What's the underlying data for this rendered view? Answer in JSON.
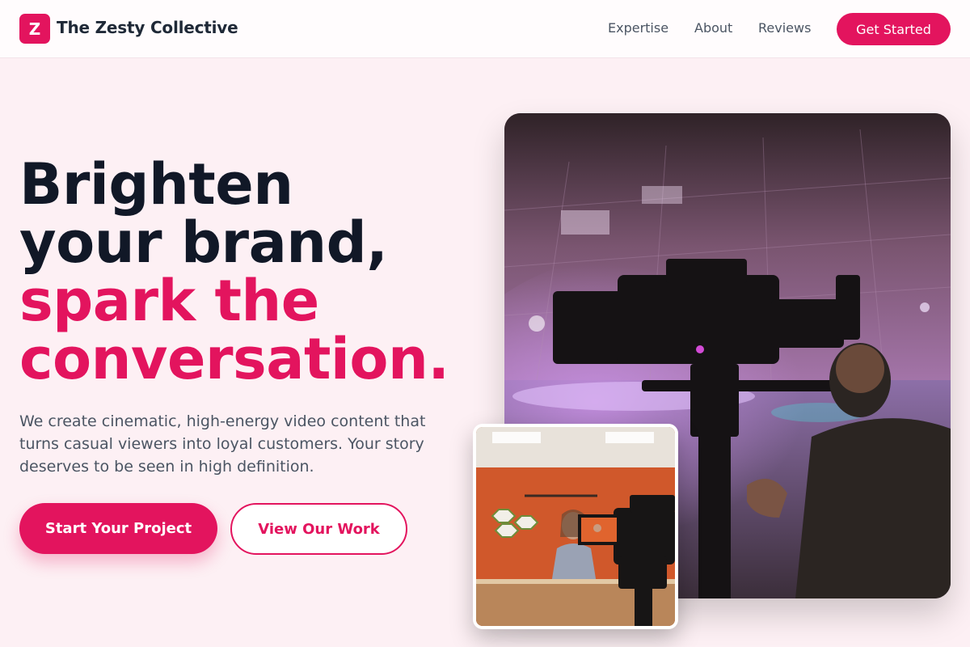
{
  "header": {
    "logo_letter": "Z",
    "brand": "The Zesty Collective",
    "nav": [
      "Expertise",
      "About",
      "Reviews"
    ],
    "cta": "Get Started"
  },
  "hero": {
    "headline_dark": [
      "Brighten",
      "your brand,"
    ],
    "headline_accent": [
      "spark the",
      "conversation."
    ],
    "lead": "We create cinematic, high-energy video content that turns casual viewers into loyal customers. Your story deserves to be seen in high definition.",
    "primary_button": "Start Your Project",
    "secondary_button": "View Our Work"
  },
  "colors": {
    "accent": "#e3145e",
    "background": "#fdf0f4",
    "heading": "#111827",
    "body_text": "#4b5563"
  },
  "images": {
    "main": "camera-operator-photo",
    "inset": "studio-camera-presenter-photo"
  }
}
